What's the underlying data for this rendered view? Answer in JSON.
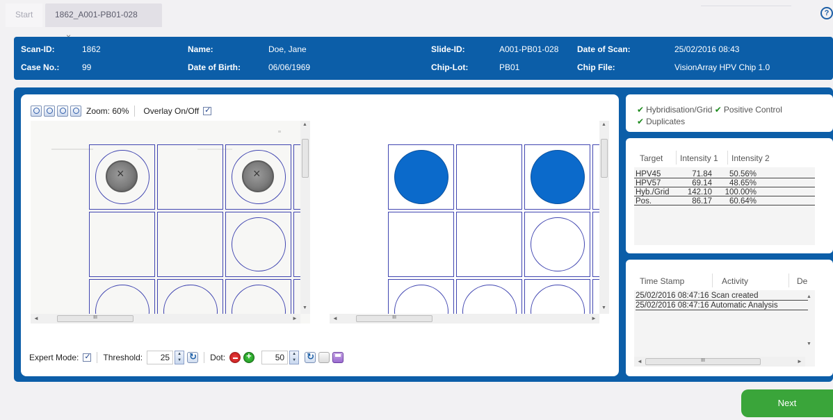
{
  "tabs": [
    {
      "label": "Start"
    },
    {
      "label": "1862_A001-PB01-028",
      "close": "×"
    }
  ],
  "header": {
    "scan_id_label": "Scan-ID:",
    "scan_id": "1862",
    "case_no_label": "Case No.:",
    "case_no": "99",
    "name_label": "Name:",
    "name": "Doe, Jane",
    "dob_label": "Date of Birth:",
    "dob": "06/06/1969",
    "slide_id_label": "Slide-ID:",
    "slide_id": "A001-PB01-028",
    "chip_lot_label": "Chip-Lot:",
    "chip_lot": "PB01",
    "date_of_scan_label": "Date of Scan:",
    "date_of_scan": "25/02/2016 08:43",
    "chip_file_label": "Chip File:",
    "chip_file": "VisionArray HPV Chip 1.0"
  },
  "toolbar": {
    "zoom_label": "Zoom: 60%",
    "overlay_label": "Overlay On/Off",
    "overlay_checked": true
  },
  "bottombar": {
    "expert_mode_label": "Expert Mode:",
    "expert_mode_checked": true,
    "threshold_label": "Threshold:",
    "threshold_value": "25",
    "dot_label": "Dot:",
    "dot_value": "50"
  },
  "scrollbar": {
    "grip": "III",
    "up": "▲",
    "down": "▼",
    "left": "◄",
    "right": "►"
  },
  "qc": {
    "check": "✔",
    "items": [
      "Hybridisation/Grid",
      "Positive Control",
      "Duplicates"
    ]
  },
  "results": {
    "headers": [
      "Target",
      "Intensity 1",
      "Intensity 2"
    ],
    "rows": [
      {
        "target": "HPV45",
        "i1": "71.84",
        "i2": "50.56%"
      },
      {
        "target": "HPV57",
        "i1": "69.14",
        "i2": "48.65%"
      },
      {
        "target": "Hyb./Grid",
        "i1": "142.10",
        "i2": "100.00%"
      },
      {
        "target": "Pos.",
        "i1": "86.17",
        "i2": "60.64%"
      }
    ]
  },
  "log": {
    "headers": [
      "Time Stamp",
      "Activity",
      "De"
    ],
    "rows": [
      "25/02/2016 08:47:16 Scan created",
      "25/02/2016 08:47:16 Automatic Analysis"
    ]
  },
  "next_label": "Next",
  "colors": {
    "header_blue": "#0c5ea8",
    "spot_blue": "#0b6acb",
    "next_green": "#3aa53a"
  }
}
